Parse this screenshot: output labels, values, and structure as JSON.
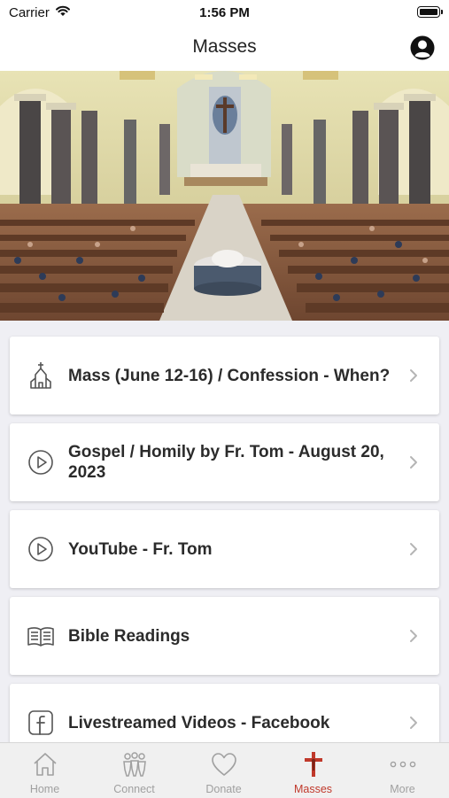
{
  "status": {
    "carrier": "Carrier",
    "time": "1:56 PM"
  },
  "nav": {
    "title": "Masses"
  },
  "items": [
    {
      "label": "Mass (June 12-16) / Confession - When?",
      "icon": "church-icon"
    },
    {
      "label": "Gospel / Homily by Fr. Tom - August 20, 2023",
      "icon": "play-circle-icon"
    },
    {
      "label": "YouTube - Fr. Tom",
      "icon": "play-circle-icon"
    },
    {
      "label": "Bible Readings",
      "icon": "book-icon"
    },
    {
      "label": "Livestreamed Videos - Facebook",
      "icon": "facebook-icon"
    }
  ],
  "tabs": [
    {
      "label": "Home",
      "icon": "home-icon"
    },
    {
      "label": "Connect",
      "icon": "people-icon"
    },
    {
      "label": "Donate",
      "icon": "heart-icon"
    },
    {
      "label": "Masses",
      "icon": "crucifix-icon",
      "active": true
    },
    {
      "label": "More",
      "icon": "more-dots-icon"
    }
  ],
  "colors": {
    "accent": "#c0392b",
    "tab_inactive": "#a0a0a0",
    "background": "#efeff4"
  }
}
